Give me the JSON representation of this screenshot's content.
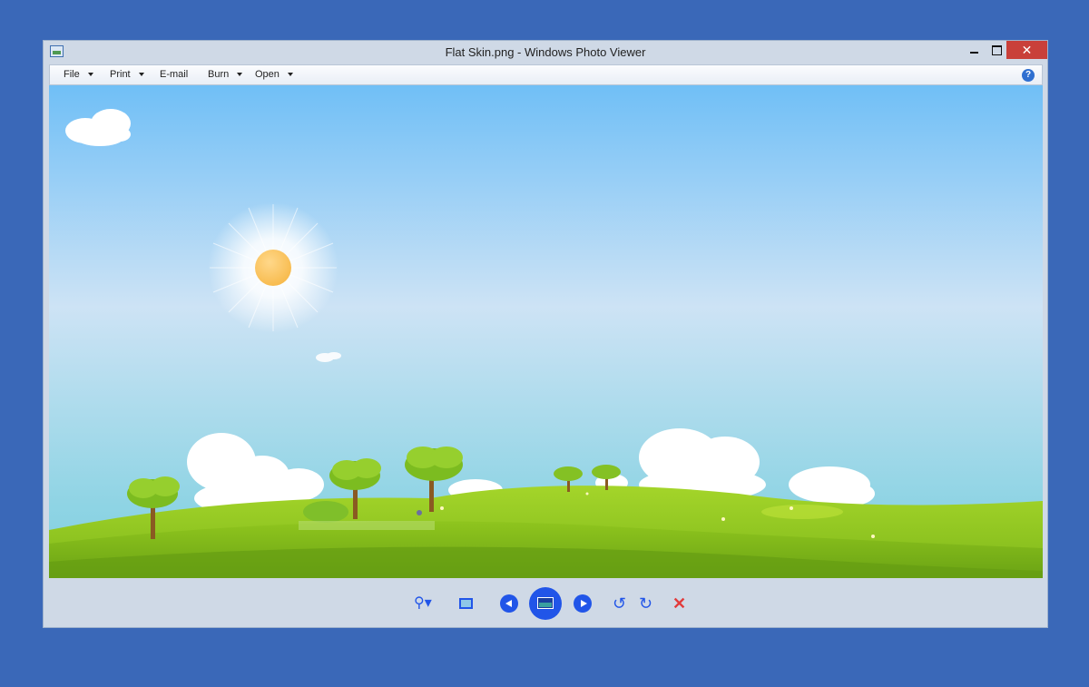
{
  "window": {
    "title": "Flat Skin.png - Windows Photo Viewer",
    "controls": {
      "minimize": "",
      "maximize": "",
      "close": "✕"
    }
  },
  "menu": {
    "items": [
      {
        "label": "File",
        "has_dropdown": true
      },
      {
        "label": "Print",
        "has_dropdown": true
      },
      {
        "label": "E-mail",
        "has_dropdown": false
      },
      {
        "label": "Burn",
        "has_dropdown": true
      },
      {
        "label": "Open",
        "has_dropdown": true
      }
    ],
    "help": "?"
  },
  "toolbar": {
    "zoom": "⚲▾",
    "rotate_ccw": "↺",
    "rotate_cw": "↻",
    "delete": "✕"
  },
  "icons": [
    "app-icon",
    "help-icon",
    "zoom-icon",
    "actual-size-icon",
    "previous-icon",
    "slideshow-icon",
    "next-icon",
    "rotate-counterclockwise-icon",
    "rotate-clockwise-icon",
    "delete-icon"
  ],
  "colors": {
    "desktop": "#3a68b8",
    "accent": "#2155e8",
    "close": "#c9403a",
    "delete": "#e23b3b"
  }
}
